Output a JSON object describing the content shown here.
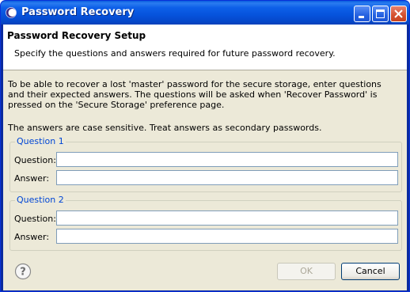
{
  "window": {
    "title": "Password Recovery",
    "icons": {
      "app": "eclipse-icon",
      "minimize": "minimize-icon",
      "maximize": "maximize-icon",
      "close": "close-icon"
    }
  },
  "header": {
    "title": "Password Recovery Setup",
    "description": "Specify the questions and answers required for future password recovery."
  },
  "intro": "To be able to recover a lost 'master' password for the secure storage, enter questions and their expected answers. The questions will be asked when 'Recover Password' is pressed on the 'Secure Storage' preference page.",
  "note": "The answers are case sensitive. Treat answers as secondary passwords.",
  "groups": [
    {
      "legend": "Question 1",
      "question_label": "Question:",
      "question_value": "",
      "answer_label": "Answer:",
      "answer_value": ""
    },
    {
      "legend": "Question 2",
      "question_label": "Question:",
      "question_value": "",
      "answer_label": "Answer:",
      "answer_value": ""
    }
  ],
  "buttons": {
    "ok": "OK",
    "cancel": "Cancel",
    "ok_enabled": false
  },
  "colors": {
    "titlebar": "#0653dc",
    "dialog_bg": "#ece9d8",
    "group_legend": "#0046d5",
    "field_border": "#7f9db9"
  }
}
